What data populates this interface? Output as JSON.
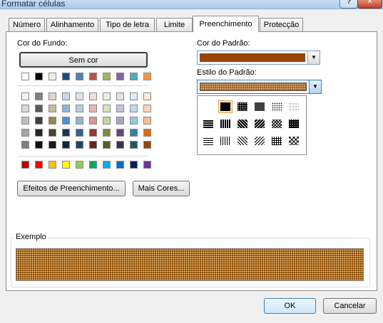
{
  "window": {
    "title": "Formatar células",
    "help_glyph": "?",
    "close_glyph": "✕"
  },
  "tabs": [
    {
      "label": "Número"
    },
    {
      "label": "Alinhamento"
    },
    {
      "label": "Tipo de letra"
    },
    {
      "label": "Limite"
    },
    {
      "label": "Preenchimento",
      "active": true
    },
    {
      "label": "Protecção"
    }
  ],
  "fill": {
    "background_label": "Cor do Fundo:",
    "no_color_button": "Sem cor",
    "fill_effects_button": "Efeitos de Preenchimento...",
    "more_colors_button": "Mais Cores..."
  },
  "palette": {
    "theme_top": [
      "#ffffff",
      "#000000",
      "#eeece1",
      "#1f497d",
      "#4f81bd",
      "#c0504d",
      "#9bbb59",
      "#8064a2",
      "#4bacc6",
      "#f79646"
    ],
    "theme_shades": [
      [
        "#f2f2f2",
        "#7f7f7f",
        "#ddd9c3",
        "#c6d9f0",
        "#dbe5f1",
        "#f2dcdb",
        "#ebf1dd",
        "#e5e0ec",
        "#dbeef3",
        "#fdeada"
      ],
      [
        "#d8d8d8",
        "#595959",
        "#c4bd97",
        "#8db3e2",
        "#b8cce4",
        "#e5b9b7",
        "#d7e3bc",
        "#ccc1d9",
        "#b7dde8",
        "#fbd5b5"
      ],
      [
        "#bfbfbf",
        "#3f3f3f",
        "#938953",
        "#548dd4",
        "#95b3d7",
        "#d99694",
        "#c3d69b",
        "#b2a2c7",
        "#92cddc",
        "#fac08f"
      ],
      [
        "#a5a5a5",
        "#262626",
        "#494429",
        "#17365d",
        "#366092",
        "#953734",
        "#76923c",
        "#5f497a",
        "#31859b",
        "#e36c09"
      ],
      [
        "#7f7f7f",
        "#0c0c0c",
        "#1d1b10",
        "#0f243e",
        "#244061",
        "#632423",
        "#4f6128",
        "#3f3151",
        "#205867",
        "#974806"
      ]
    ],
    "standard": [
      "#c00000",
      "#ff0000",
      "#ffc000",
      "#ffff00",
      "#92d050",
      "#00b050",
      "#00b0f0",
      "#0070c0",
      "#002060",
      "#7030a0"
    ]
  },
  "pattern": {
    "color_label": "Cor do Padrão:",
    "color_value": "#9a4500",
    "style_label": "Estilo do Padrão:",
    "style_value_fill": "#a0622a",
    "options_icons": [
      [
        "pattern-solid-icon",
        "pattern-75-gray-icon",
        "pattern-50-gray-icon",
        "pattern-25-gray-icon",
        "pattern-12-gray-icon"
      ],
      [
        "pattern-horiz-stripe-icon",
        "pattern-vert-stripe-icon",
        "pattern-rev-diag-stripe-icon",
        "pattern-diag-stripe-icon",
        "pattern-diag-crosshatch-icon",
        "pattern-thick-crosshatch-icon"
      ],
      [
        "pattern-thin-horiz-icon",
        "pattern-thin-vert-icon",
        "pattern-thin-rev-diag-icon",
        "pattern-thin-diag-icon",
        "pattern-thin-crosshatch-icon",
        "pattern-thin-diag-crosshatch-icon"
      ]
    ]
  },
  "sample": {
    "label": "Exemplo"
  },
  "footer": {
    "ok_button": "OK",
    "cancel_button": "Cancelar"
  }
}
